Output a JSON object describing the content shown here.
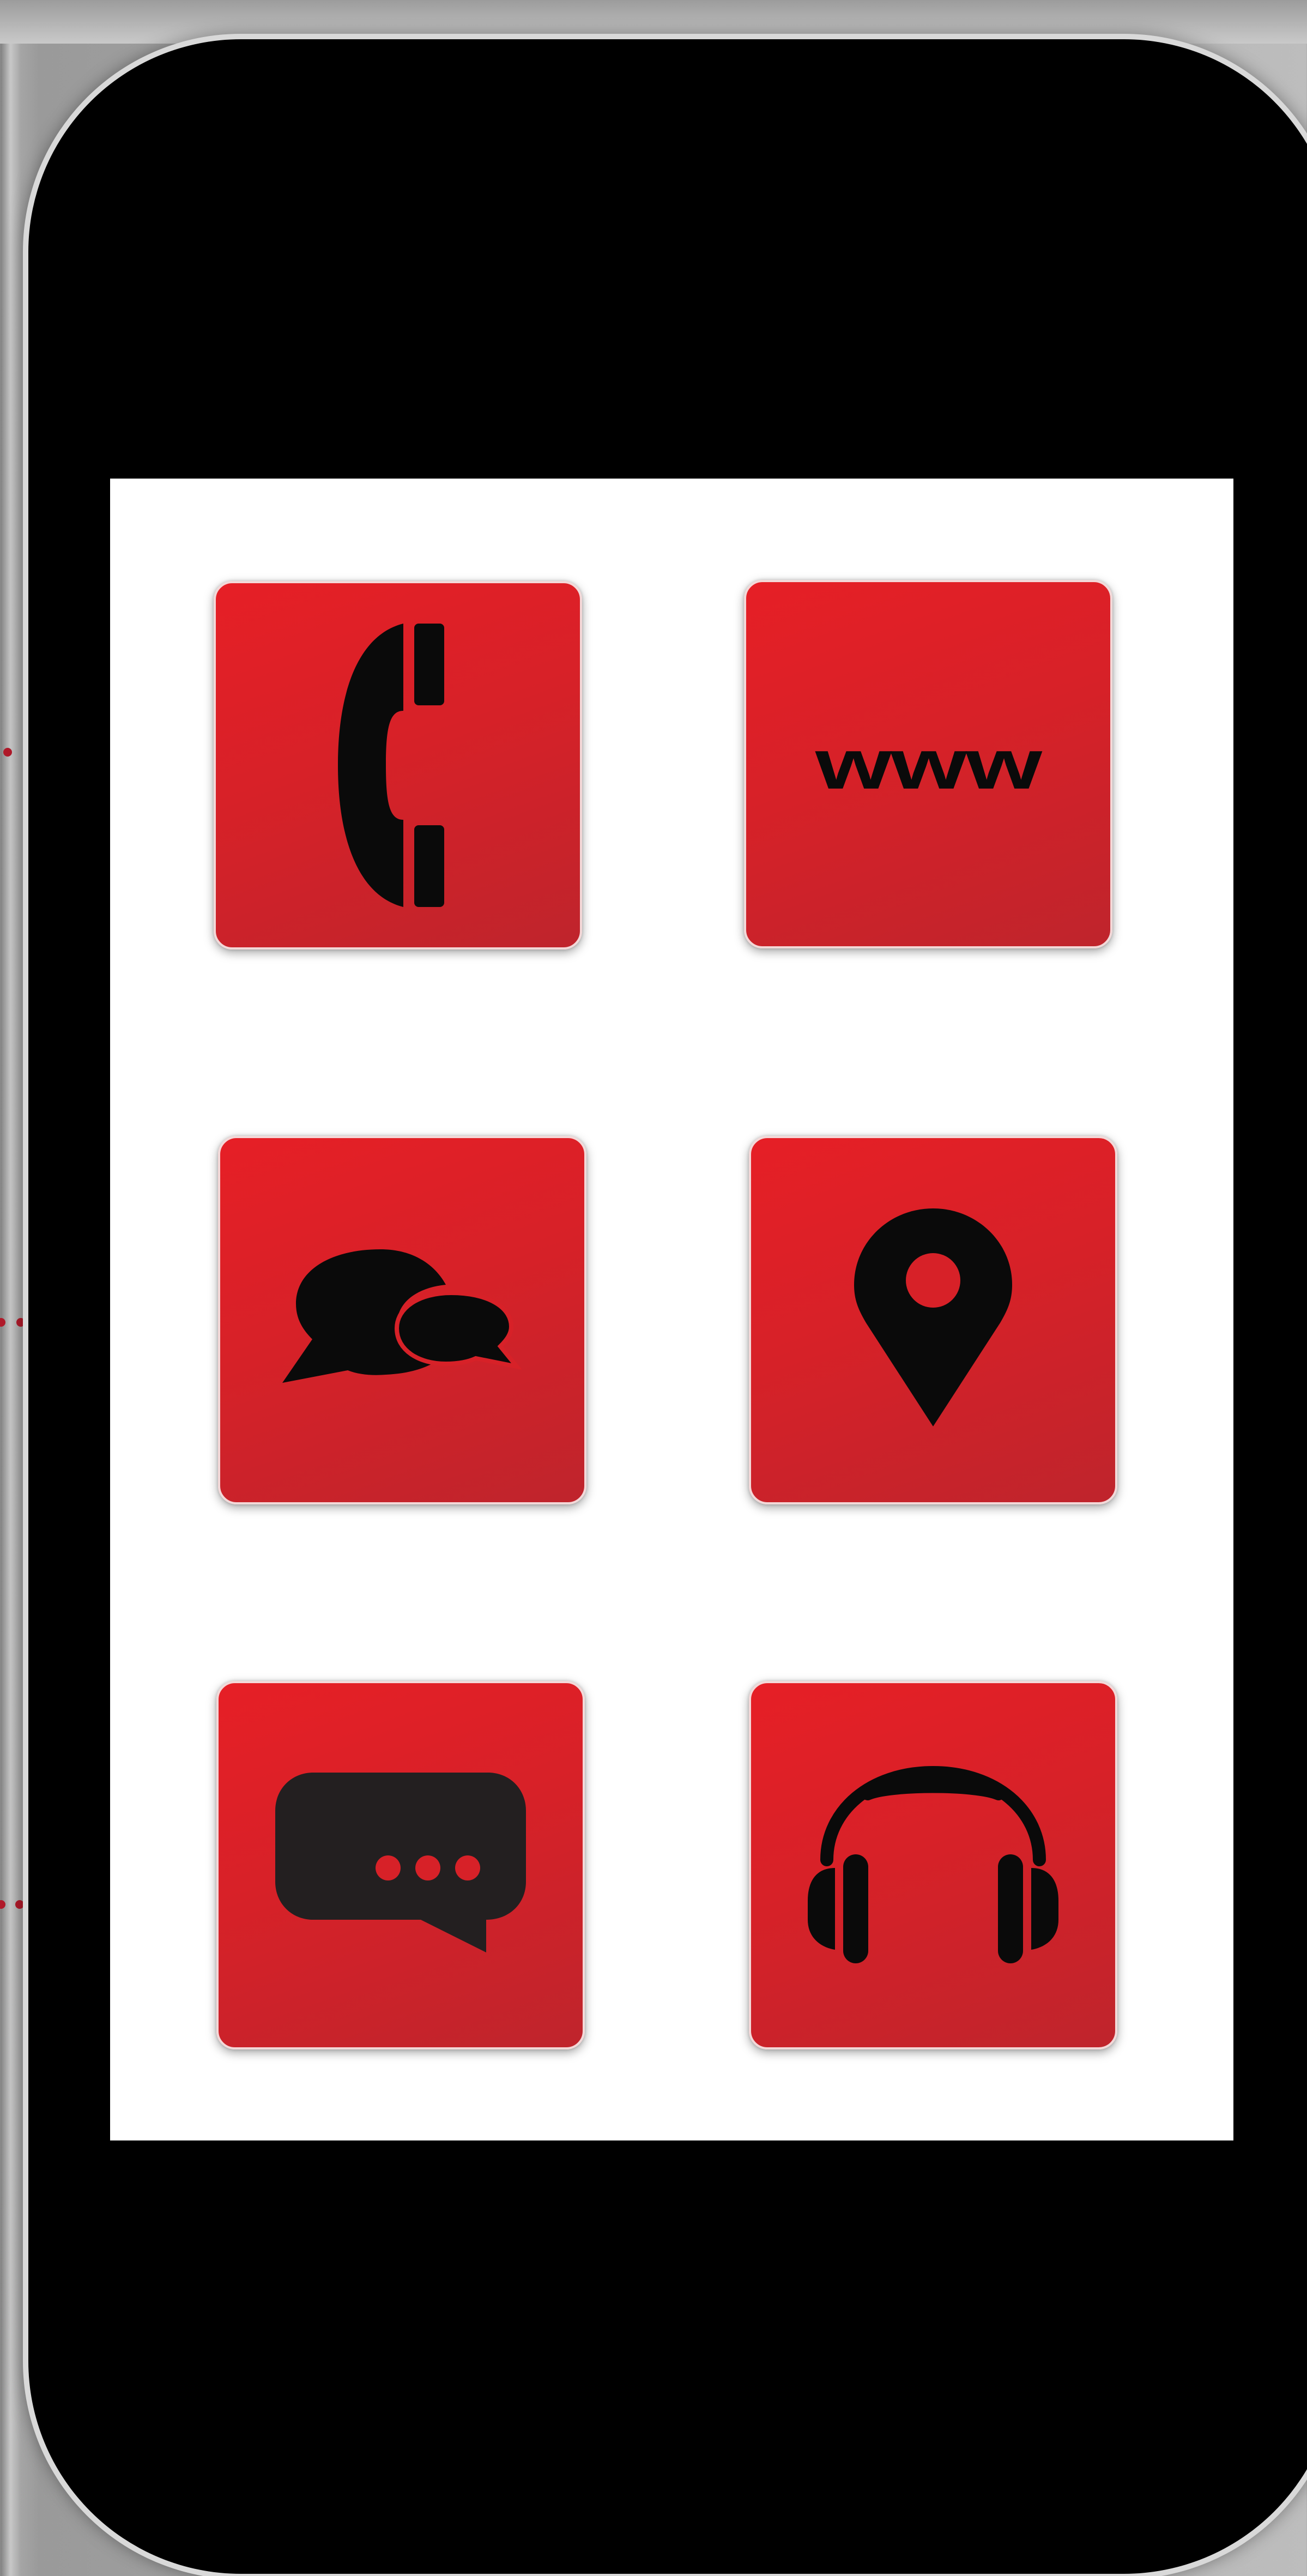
{
  "device": {
    "type": "smartphone",
    "screen_color": "#ffffff",
    "body_color": "#000000",
    "tile_color": "#d72128"
  },
  "app_grid": {
    "tiles": [
      {
        "id": "phone",
        "icon": "phone-handset-icon"
      },
      {
        "id": "web",
        "icon": "www-icon",
        "label": "www"
      },
      {
        "id": "chat",
        "icon": "speech-bubbles-icon"
      },
      {
        "id": "location",
        "icon": "map-pin-icon"
      },
      {
        "id": "messages",
        "icon": "message-typing-icon"
      },
      {
        "id": "audio",
        "icon": "headphones-icon"
      }
    ]
  }
}
